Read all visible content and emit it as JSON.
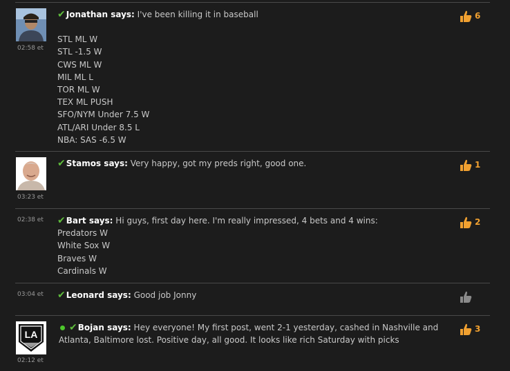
{
  "comments": [
    {
      "author": "Jonathan",
      "says": "says:",
      "time": "02:58 et",
      "lines": [
        "I've been killing it in baseball"
      ],
      "extra_lines": [
        "STL ML W",
        "STL -1.5 W",
        "CWS ML W",
        "MIL ML L",
        "TOR ML W",
        "TEX ML PUSH",
        "SFO/NYM Under 7.5 W",
        "ATL/ARI Under 8.5 L",
        "NBA: SAS -6.5 W"
      ],
      "likes": "6",
      "avatar_icon": "user-photo-icon"
    },
    {
      "author": "Stamos",
      "says": "says:",
      "time": "03:23 et",
      "lines": [
        "Very happy, got my preds right, good one."
      ],
      "likes": "1",
      "avatar_icon": "user-photo-icon"
    },
    {
      "author": "Bart",
      "says": "says:",
      "time": "02:38 et",
      "lines": [
        "Hi guys, first day here. I'm really impressed, 4 bets and 4 wins:",
        "Predators W",
        "White Sox W",
        "Braves W",
        "Cardinals W"
      ],
      "likes": "2"
    },
    {
      "author": "Leonard",
      "says": "says:",
      "time": "03:04 et",
      "lines": [
        "Good job Jonny"
      ],
      "likes": ""
    },
    {
      "author": "Bojan",
      "says": "says:",
      "time": "02:12 et",
      "lines": [
        "Hey everyone! My first post, went 2-1 yesterday, cashed in Nashville and",
        "Atlanta, Baltimore lost. Positive day, all good. It looks like rich Saturday with picks"
      ],
      "likes": "3",
      "online": true,
      "avatar_logo_text": "LA",
      "avatar_icon": "la-kings-logo-icon"
    }
  ],
  "colors": {
    "background": "#1c1c1c",
    "text": "#c9c9c9",
    "author": "#ffffff",
    "check": "#5fbd3c",
    "like_active": "#f0a030",
    "like_inactive": "#8a8a8a",
    "online_dot": "#4dc72b",
    "divider": "#4a4a4a"
  },
  "icons": {
    "check": "checkmark-icon",
    "like": "thumbs-up-icon",
    "online": "online-dot-icon"
  }
}
